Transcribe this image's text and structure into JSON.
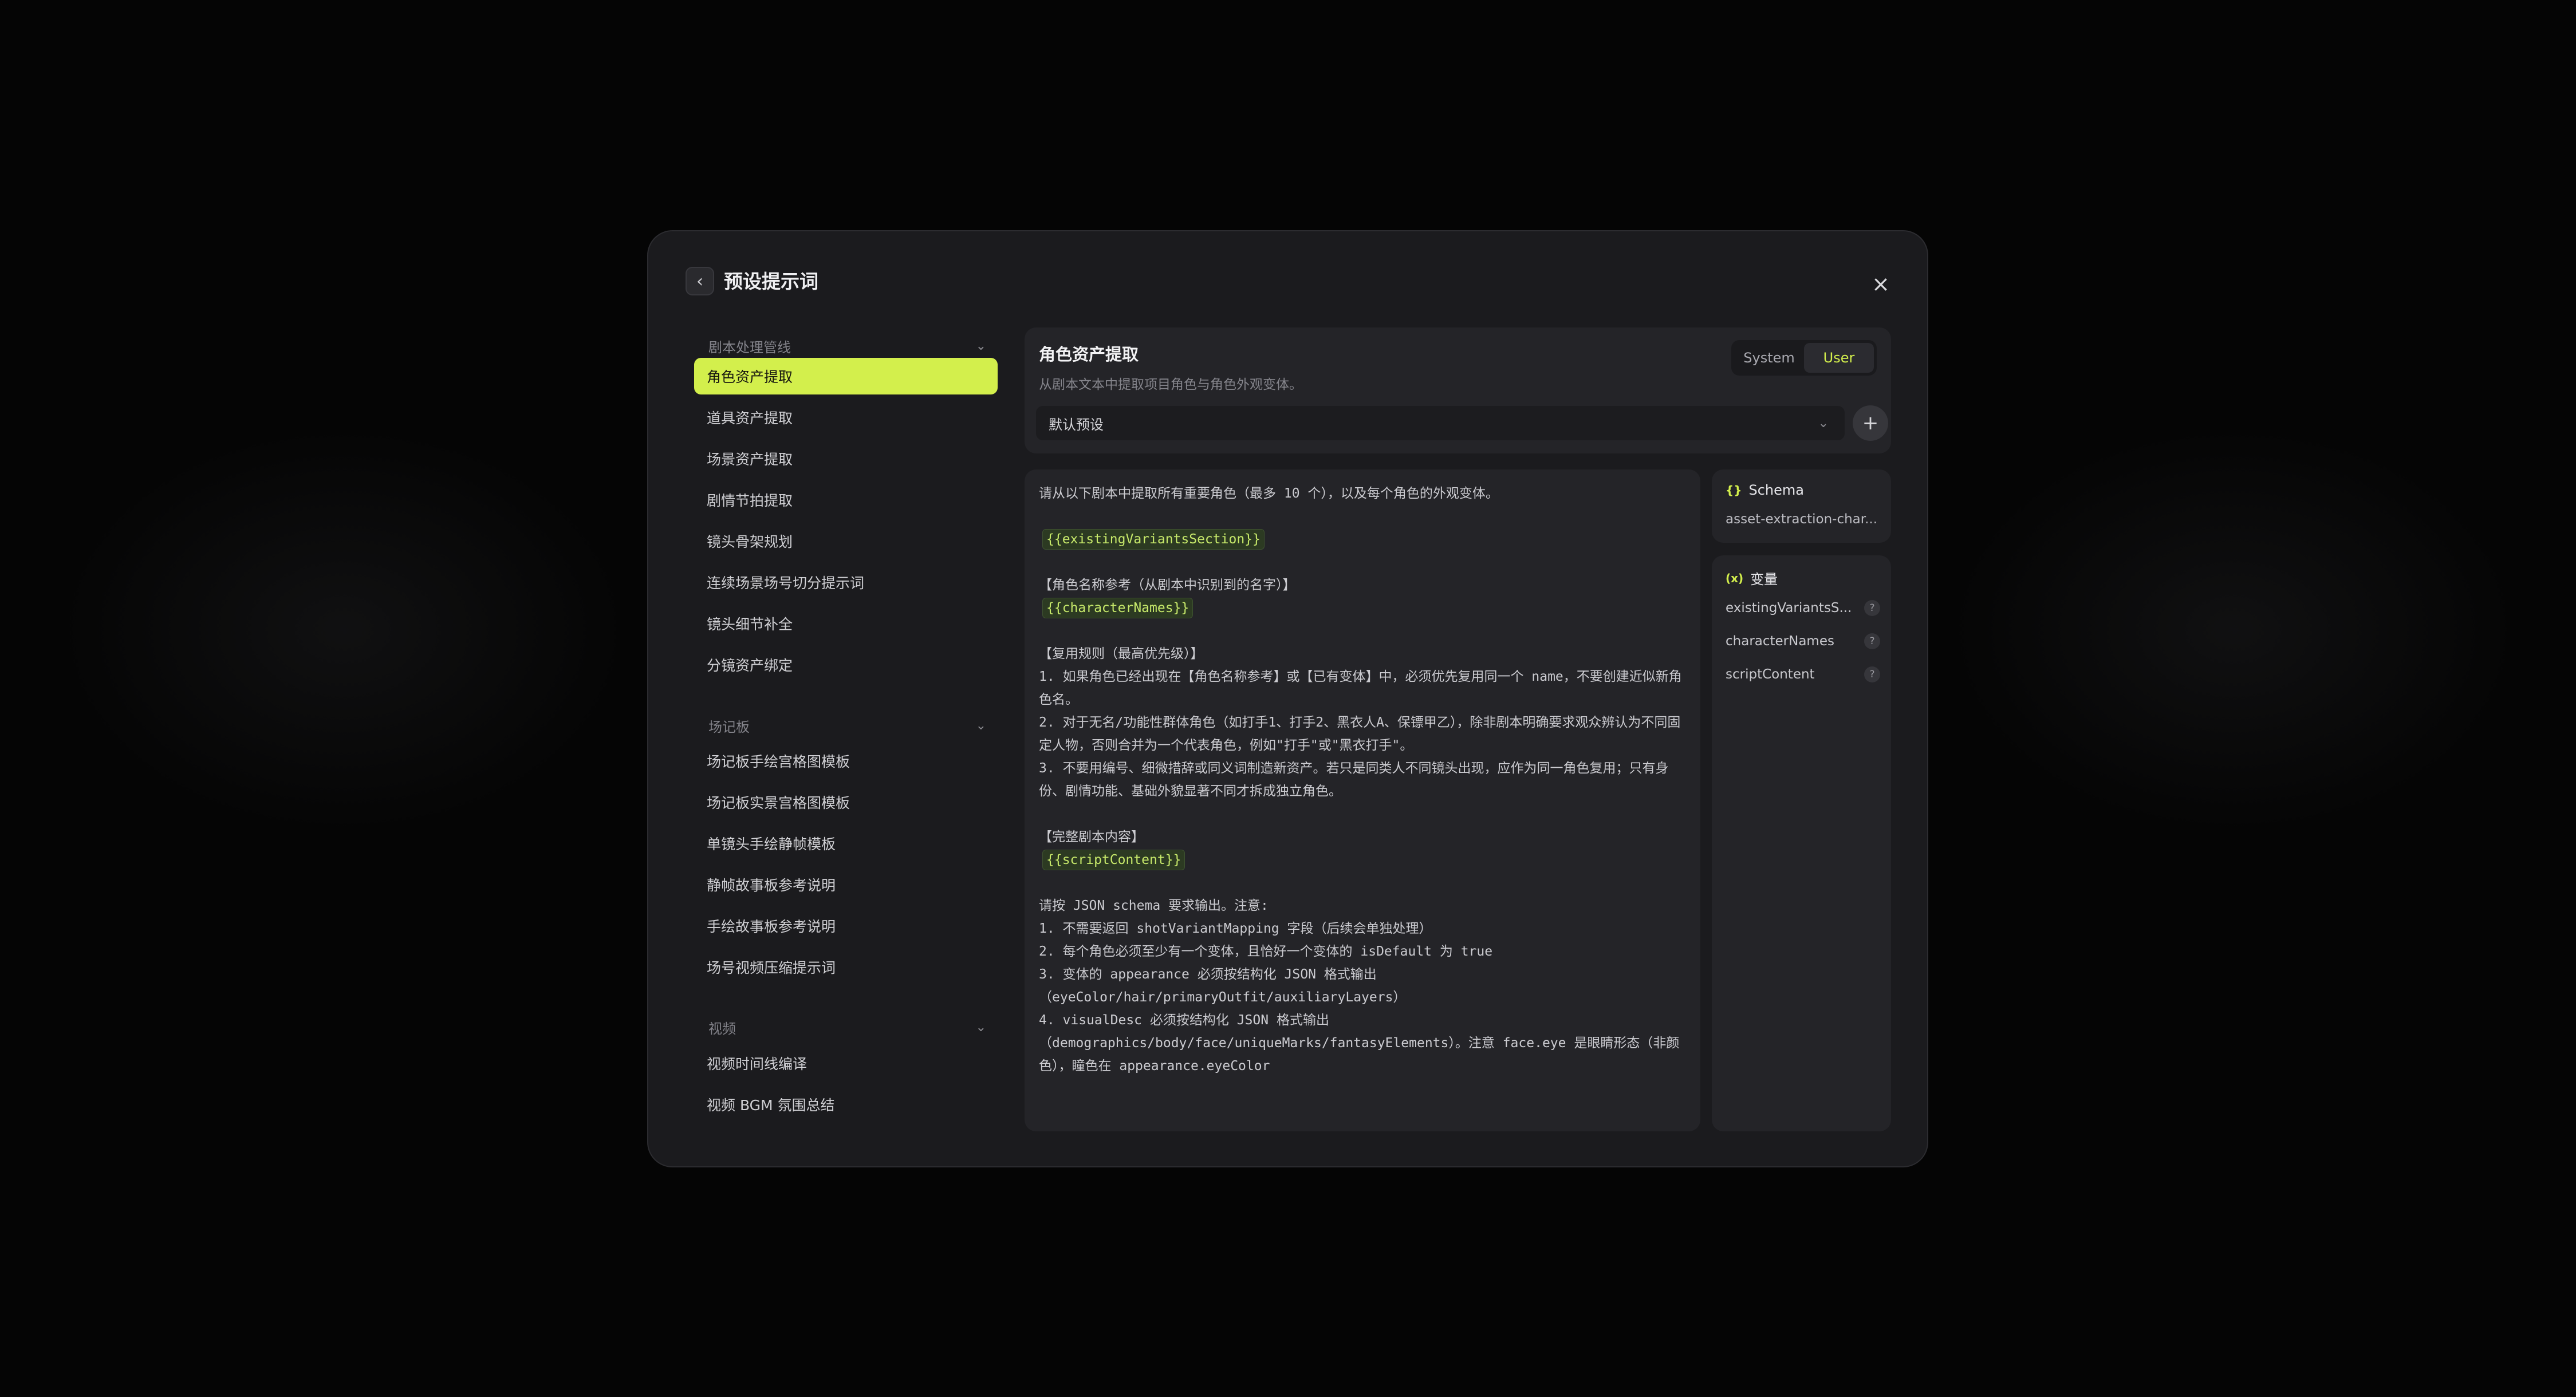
{
  "modal": {
    "title": "预设提示词"
  },
  "sidebar": {
    "groups": [
      {
        "label": "剧本处理管线",
        "items": [
          "角色资产提取",
          "道具资产提取",
          "场景资产提取",
          "剧情节拍提取",
          "镜头骨架规划",
          "连续场景场号切分提示词",
          "镜头细节补全",
          "分镜资产绑定"
        ]
      },
      {
        "label": "场记板",
        "items": [
          "场记板手绘宫格图模板",
          "场记板实景宫格图模板",
          "单镜头手绘静帧模板",
          "静帧故事板参考说明",
          "手绘故事板参考说明",
          "场号视频压缩提示词"
        ]
      },
      {
        "label": "视频",
        "items": [
          "视频时间线编译",
          "视频 BGM 氛围总结"
        ]
      }
    ]
  },
  "header": {
    "title": "角色资产提取",
    "subtitle": "从剧本文本中提取项目角色与角色外观变体。",
    "tabs": [
      "System",
      "User"
    ],
    "active_tab": "User",
    "preset_value": "默认预设"
  },
  "editor": {
    "lines": [
      "请从以下剧本中提取所有重要角色（最多 10 个），以及每个角色的外观变体。",
      "",
      "{{existingVariantsSection}}",
      "",
      "【角色名称参考（从剧本中识别到的名字）】",
      "{{characterNames}}",
      "",
      "【复用规则（最高优先级）】",
      "1. 如果角色已经出现在【角色名称参考】或【已有变体】中，必须优先复用同一个 name，不要创建近似新角色名。",
      "2. 对于无名/功能性群体角色（如打手1、打手2、黑衣人A、保镖甲乙），除非剧本明确要求观众辨认为不同固定人物，否则合并为一个代表角色，例如\"打手\"或\"黑衣打手\"。",
      "3. 不要用编号、细微措辞或同义词制造新资产。若只是同类人不同镜头出现，应作为同一角色复用；只有身份、剧情功能、基础外貌显著不同才拆成独立角色。",
      "",
      "【完整剧本内容】",
      "{{scriptContent}}",
      "",
      "请按 JSON schema 要求输出。注意:",
      "1. 不需要返回 shotVariantMapping 字段（后续会单独处理）",
      "2. 每个角色必须至少有一个变体，且恰好一个变体的 isDefault 为 true",
      "3. 变体的 appearance 必须按结构化 JSON 格式输出",
      "（eyeColor/hair/primaryOutfit/auxiliaryLayers）",
      "4. visualDesc 必须按结构化 JSON 格式输出",
      "（demographics/body/face/uniqueMarks/fantasyElements）。注意 face.eye 是眼睛形态（非颜色），瞳色在 appearance.eyeColor"
    ]
  },
  "schema": {
    "label": "Schema",
    "icon": "{}",
    "value": "asset-extraction-char..."
  },
  "variables": {
    "label": "变量",
    "icon": "(x)",
    "items": [
      "existingVariantsS...",
      "characterNames",
      "scriptContent"
    ]
  },
  "icons": {
    "back": "chevron-left-icon",
    "close": "close-icon",
    "chevron": "chevron-down-icon",
    "add": "plus-icon",
    "help": "question-icon"
  },
  "colors": {
    "accent": "#d3ef4c",
    "modal_bg": "#1b1b1e",
    "card_bg": "#242428",
    "chip_bg": "#2c3a22",
    "chip_text": "#c6e86a"
  }
}
